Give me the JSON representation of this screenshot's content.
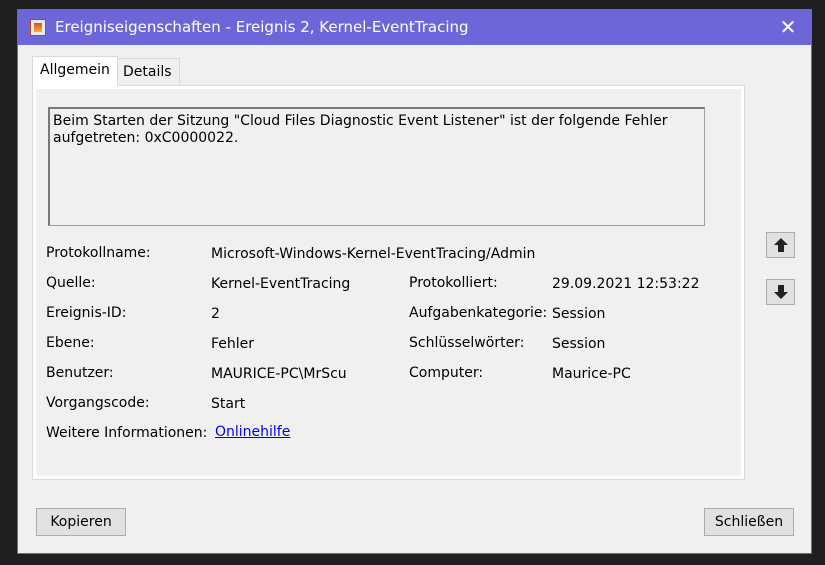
{
  "window": {
    "title": "Ereigniseigenschaften - Ereignis 2, Kernel-EventTracing",
    "close_glyph": "✕"
  },
  "tabs": [
    {
      "label": "Allgemein",
      "active": true
    },
    {
      "label": "Details",
      "active": false
    }
  ],
  "message": "Beim Starten der Sitzung \"Cloud Files Diagnostic Event Listener\" ist der folgende Fehler aufgetreten: 0xC0000022.",
  "fields": {
    "protokollname": {
      "label": "Protokollname:",
      "value": "Microsoft-Windows-Kernel-EventTracing/Admin"
    },
    "quelle": {
      "label": "Quelle:",
      "value": "Kernel-EventTracing"
    },
    "protokolliert": {
      "label": "Protokolliert:",
      "value": "29.09.2021 12:53:22"
    },
    "ereignis_id": {
      "label": "Ereignis-ID:",
      "value": "2"
    },
    "aufgabenkategorie": {
      "label": "Aufgabenkategorie:",
      "value": "Session"
    },
    "ebene": {
      "label": "Ebene:",
      "value": "Fehler"
    },
    "schluesselwoerter": {
      "label": "Schlüsselwörter:",
      "value": "Session"
    },
    "benutzer": {
      "label": "Benutzer:",
      "value": "MAURICE-PC\\MrScu"
    },
    "computer": {
      "label": "Computer:",
      "value": "Maurice-PC"
    },
    "vorgangscode": {
      "label": "Vorgangscode:",
      "value": "Start"
    },
    "weitere_informationen": {
      "label": "Weitere Informationen:",
      "value": "Onlinehilfe"
    }
  },
  "buttons": {
    "copy": "Kopieren",
    "close": "Schließen"
  },
  "icons": {
    "nav_up": "arrow-up-icon",
    "nav_down": "arrow-down-icon"
  },
  "colors": {
    "titlebar": "#6c66d9",
    "link": "#0000ee"
  }
}
